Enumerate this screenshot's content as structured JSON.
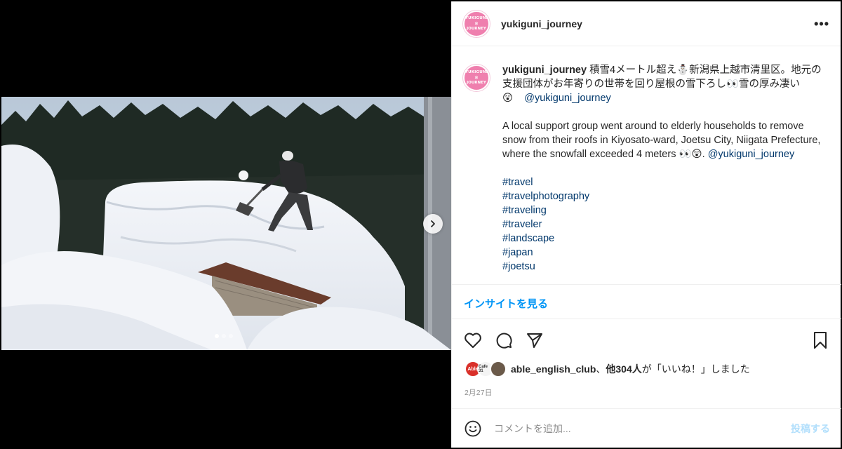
{
  "post": {
    "username": "yukiguni_journey",
    "avatar_text": {
      "line1": "YUKIGUNI",
      "line2": "❄",
      "line3": "JOURNEY"
    },
    "more_label": "•••",
    "media_alt": "積雪4メートル超えの屋根で雪下ろしをする人物",
    "carousel": {
      "count": 3,
      "active": 0
    }
  },
  "caption": {
    "username": "yukiguni_journey",
    "jp_text": "積雪4メートル超え⛄新潟県上越市清里区。地元の支援団体がお年寄りの世帯を回り屋根の雪下ろし👀雪の厚み凄い😲",
    "jp_mention": "@yukiguni_journey",
    "en_text": "A local support group went around to elderly households to remove snow from their roofs in Kiyosato-ward, Joetsu City, Niigata Prefecture, where the snowfall exceeded 4 meters 👀😲.",
    "en_mention": "@yukiguni_journey",
    "hashtags": [
      "#travel",
      "#travelphotography",
      "#traveling",
      "#traveler",
      "#landscape",
      "#japan",
      "#joetsu"
    ]
  },
  "insights_label": "インサイトを見る",
  "actions": {
    "like": "heart-icon",
    "comment": "comment-icon",
    "share": "send-icon",
    "save": "bookmark-icon"
  },
  "likes": {
    "first_liker": "able_english_club",
    "separator": "、",
    "others": "他304人",
    "suffix": "が「いいね！」しました",
    "avatars": [
      "Able",
      "Cafe 31",
      ""
    ]
  },
  "date": "2月27日",
  "comment": {
    "placeholder": "コメントを追加...",
    "post_label": "投稿する"
  },
  "colors": {
    "link": "#00376b",
    "accent": "#0095f6",
    "post_disabled": "#b2dffc",
    "avatar": "#ef7fae"
  }
}
